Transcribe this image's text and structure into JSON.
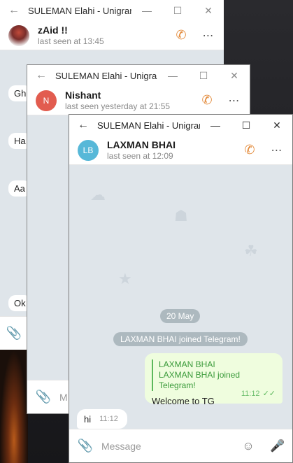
{
  "windows": [
    {
      "title": "SULEMAN Elahi - Unigram",
      "chat_name": "zAid !!",
      "status": "last seen at 13:45",
      "bg_messages": [
        "Gh",
        "Ha",
        "Aa",
        "Ok"
      ]
    },
    {
      "title": "SULEMAN Elahi - Unigram",
      "chat_name": "Nishant",
      "avatar_initials": "N",
      "status": "last seen yesterday at 21:55",
      "composer_placeholder": "M"
    },
    {
      "title": "SULEMAN Elahi - Unigram",
      "chat_name": "LAXMAN BHAI",
      "avatar_initials": "LB",
      "status": "last seen at 12:09",
      "date_separator": "20 May",
      "service_message": "LAXMAN BHAI joined Telegram!",
      "outgoing": {
        "reply_name": "LAXMAN BHAI",
        "reply_text": "LAXMAN BHAI joined Telegram!",
        "text": "Welcome to TG",
        "time": "11:12"
      },
      "incoming": {
        "text": "hi",
        "time": "11:12"
      },
      "composer_placeholder": "Message"
    }
  ],
  "colors": {
    "accent_call": "#e38a3a",
    "avatar_nishant": "#e25c4f",
    "avatar_laxman": "#57b8d8",
    "outgoing_bubble": "#effdde",
    "chat_background": "#dfe5ea"
  },
  "icons": [
    "back-arrow-icon",
    "minimize-icon",
    "maximize-icon",
    "close-icon",
    "phone-icon",
    "more-icon",
    "attach-icon",
    "sticker-icon",
    "mic-icon",
    "double-check-icon"
  ]
}
